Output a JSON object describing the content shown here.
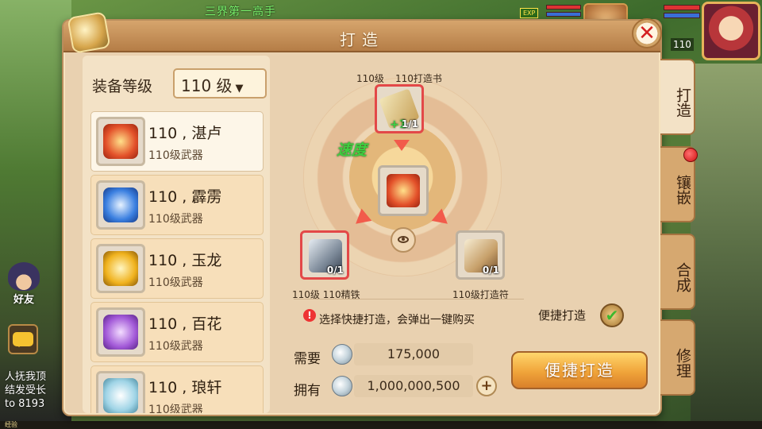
{
  "background": {
    "top_title": "三界第一高手",
    "exp_badge": "EXP",
    "player_level_tag": "110",
    "friends_label": "好友",
    "chat_lines": [
      "人抚我顶",
      "结发受长",
      "to 8193"
    ],
    "exp_label": "经验"
  },
  "dialog": {
    "title": "打造",
    "close_icon": "close-x-icon",
    "level_label": "装备等级",
    "level_value": "110 级",
    "weapons": [
      {
        "name": "110 , 湛卢",
        "sub": "110级武器",
        "selected": true,
        "color": "#e3512a"
      },
      {
        "name": "110 , 霹雳",
        "sub": "110级武器",
        "selected": false,
        "color": "#3a7fe0"
      },
      {
        "name": "110 , 玉龙",
        "sub": "110级武器",
        "selected": false,
        "color": "#f0b21e"
      },
      {
        "name": "110 , 百花",
        "sub": "110级武器",
        "selected": false,
        "color": "#a35ad8"
      },
      {
        "name": "110 , 琅轩",
        "sub": "110级武器",
        "selected": false,
        "color": "#9fd4e6"
      }
    ],
    "craft": {
      "top_caption_level": "110级",
      "top_caption_name": "110打造书",
      "speed_label": "速度",
      "top_plus": "+1",
      "top_count": "1/1",
      "left_count": "0/1",
      "right_count": "0/1",
      "left_caption": "110级 110精铁",
      "right_caption": "110级打造符"
    },
    "notice": "选择快捷打造，会弹出一键购买",
    "quick_craft_label": "便捷打造",
    "quick_craft_checked": true,
    "need_label": "需要",
    "need_value": "175,000",
    "have_label": "拥有",
    "have_value": "1,000,000,500",
    "craft_button": "便捷打造"
  },
  "tabs": [
    {
      "label": "打造",
      "active": true
    },
    {
      "label": "镶嵌",
      "active": false,
      "badge": true
    },
    {
      "label": "合成",
      "active": false
    },
    {
      "label": "修理",
      "active": false
    }
  ]
}
